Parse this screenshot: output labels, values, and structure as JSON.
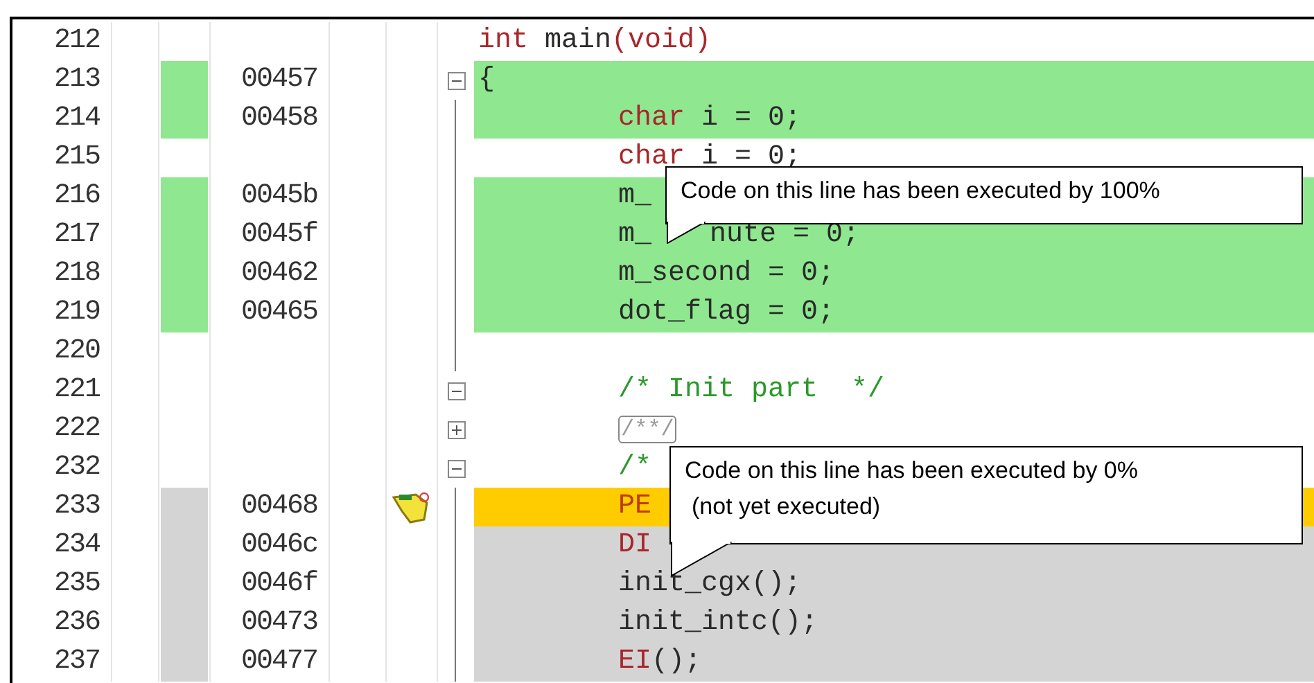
{
  "rows": [
    {
      "line": "212",
      "code": [
        {
          "text": "int",
          "kind": "keyword"
        },
        {
          "text": " main",
          "kind": "plain"
        },
        {
          "text": "(void)",
          "kind": "keyword"
        }
      ]
    },
    {
      "line": "213",
      "address": "00457",
      "kind": "executed",
      "fold": {
        "kind": "box",
        "expanded": true
      },
      "code": [
        {
          "text": "{",
          "kind": "plain"
        }
      ]
    },
    {
      "line": "214",
      "address": "00458",
      "kind": "executed",
      "fold": {
        "kind": "guide"
      },
      "indented": true,
      "code": [
        {
          "text": "char",
          "kind": "keyword"
        },
        {
          "text": " i = 0;",
          "kind": "plain"
        }
      ]
    },
    {
      "line": "215",
      "fold": {
        "kind": "guide"
      },
      "indented": true,
      "code": [
        {
          "text": "char",
          "kind": "keyword"
        },
        {
          "text": " i = 0;",
          "kind": "plain"
        }
      ]
    },
    {
      "line": "216",
      "address": "0045b",
      "kind": "executed",
      "fold": {
        "kind": "guide"
      },
      "indented": true,
      "code": [
        {
          "text": "m_",
          "kind": "plain"
        }
      ]
    },
    {
      "line": "217",
      "address": "0045f",
      "kind": "executed",
      "fold": {
        "kind": "guide"
      },
      "indented": true,
      "code": [
        {
          "text": "m_",
          "kind": "plain"
        }
      ],
      "tail": "nute = 0;"
    },
    {
      "line": "218",
      "address": "00462",
      "kind": "executed",
      "fold": {
        "kind": "guide"
      },
      "indented": true,
      "code": [
        {
          "text": "m_second = 0;",
          "kind": "plain"
        }
      ]
    },
    {
      "line": "219",
      "address": "00465",
      "kind": "executed",
      "fold": {
        "kind": "guide"
      },
      "indented": true,
      "code": [
        {
          "text": "dot_flag = 0;",
          "kind": "plain"
        }
      ]
    },
    {
      "line": "220",
      "fold": {
        "kind": "guide"
      }
    },
    {
      "line": "221",
      "fold": {
        "kind": "box",
        "expanded": true
      },
      "indented": true,
      "code": [
        {
          "text": "/* Init part  */",
          "kind": "comment"
        }
      ]
    },
    {
      "line": "222",
      "fold": {
        "kind": "box",
        "expanded": false
      },
      "indented": true,
      "code": [
        {
          "text": "/**/",
          "kind": "collapsed"
        }
      ]
    },
    {
      "line": "232",
      "fold": {
        "kind": "box",
        "expanded": true
      },
      "indented": true,
      "code": [
        {
          "text": "/*",
          "kind": "comment"
        }
      ]
    },
    {
      "line": "233",
      "address": "00468",
      "kind": "current",
      "fold": {
        "kind": "guide"
      },
      "indented": true,
      "code": [
        {
          "text": "PE",
          "kind": "register"
        }
      ]
    },
    {
      "line": "234",
      "address": "0046c",
      "kind": "not_executed",
      "fold": {
        "kind": "guide"
      },
      "indented": true,
      "code": [
        {
          "text": "DI",
          "kind": "keyword"
        }
      ]
    },
    {
      "line": "235",
      "address": "0046f",
      "kind": "not_executed",
      "fold": {
        "kind": "guide"
      },
      "indented": true,
      "code": [
        {
          "text": "init_cgx();",
          "kind": "plain"
        }
      ]
    },
    {
      "line": "236",
      "address": "00473",
      "kind": "not_executed",
      "fold": {
        "kind": "guide"
      },
      "indented": true,
      "code": [
        {
          "text": "init_intc();",
          "kind": "plain"
        }
      ]
    },
    {
      "line": "237",
      "address": "00477",
      "kind": "not_executed",
      "fold": {
        "kind": "guide"
      },
      "indented": true,
      "code": [
        {
          "text": "EI",
          "kind": "keyword"
        },
        {
          "text": "();",
          "kind": "plain"
        }
      ]
    }
  ],
  "callouts": [
    {
      "lines": [
        "Code on this line has been executed by 100%"
      ]
    },
    {
      "lines": [
        "Code on this line has been executed by 0%",
        "(not yet executed)"
      ]
    }
  ]
}
